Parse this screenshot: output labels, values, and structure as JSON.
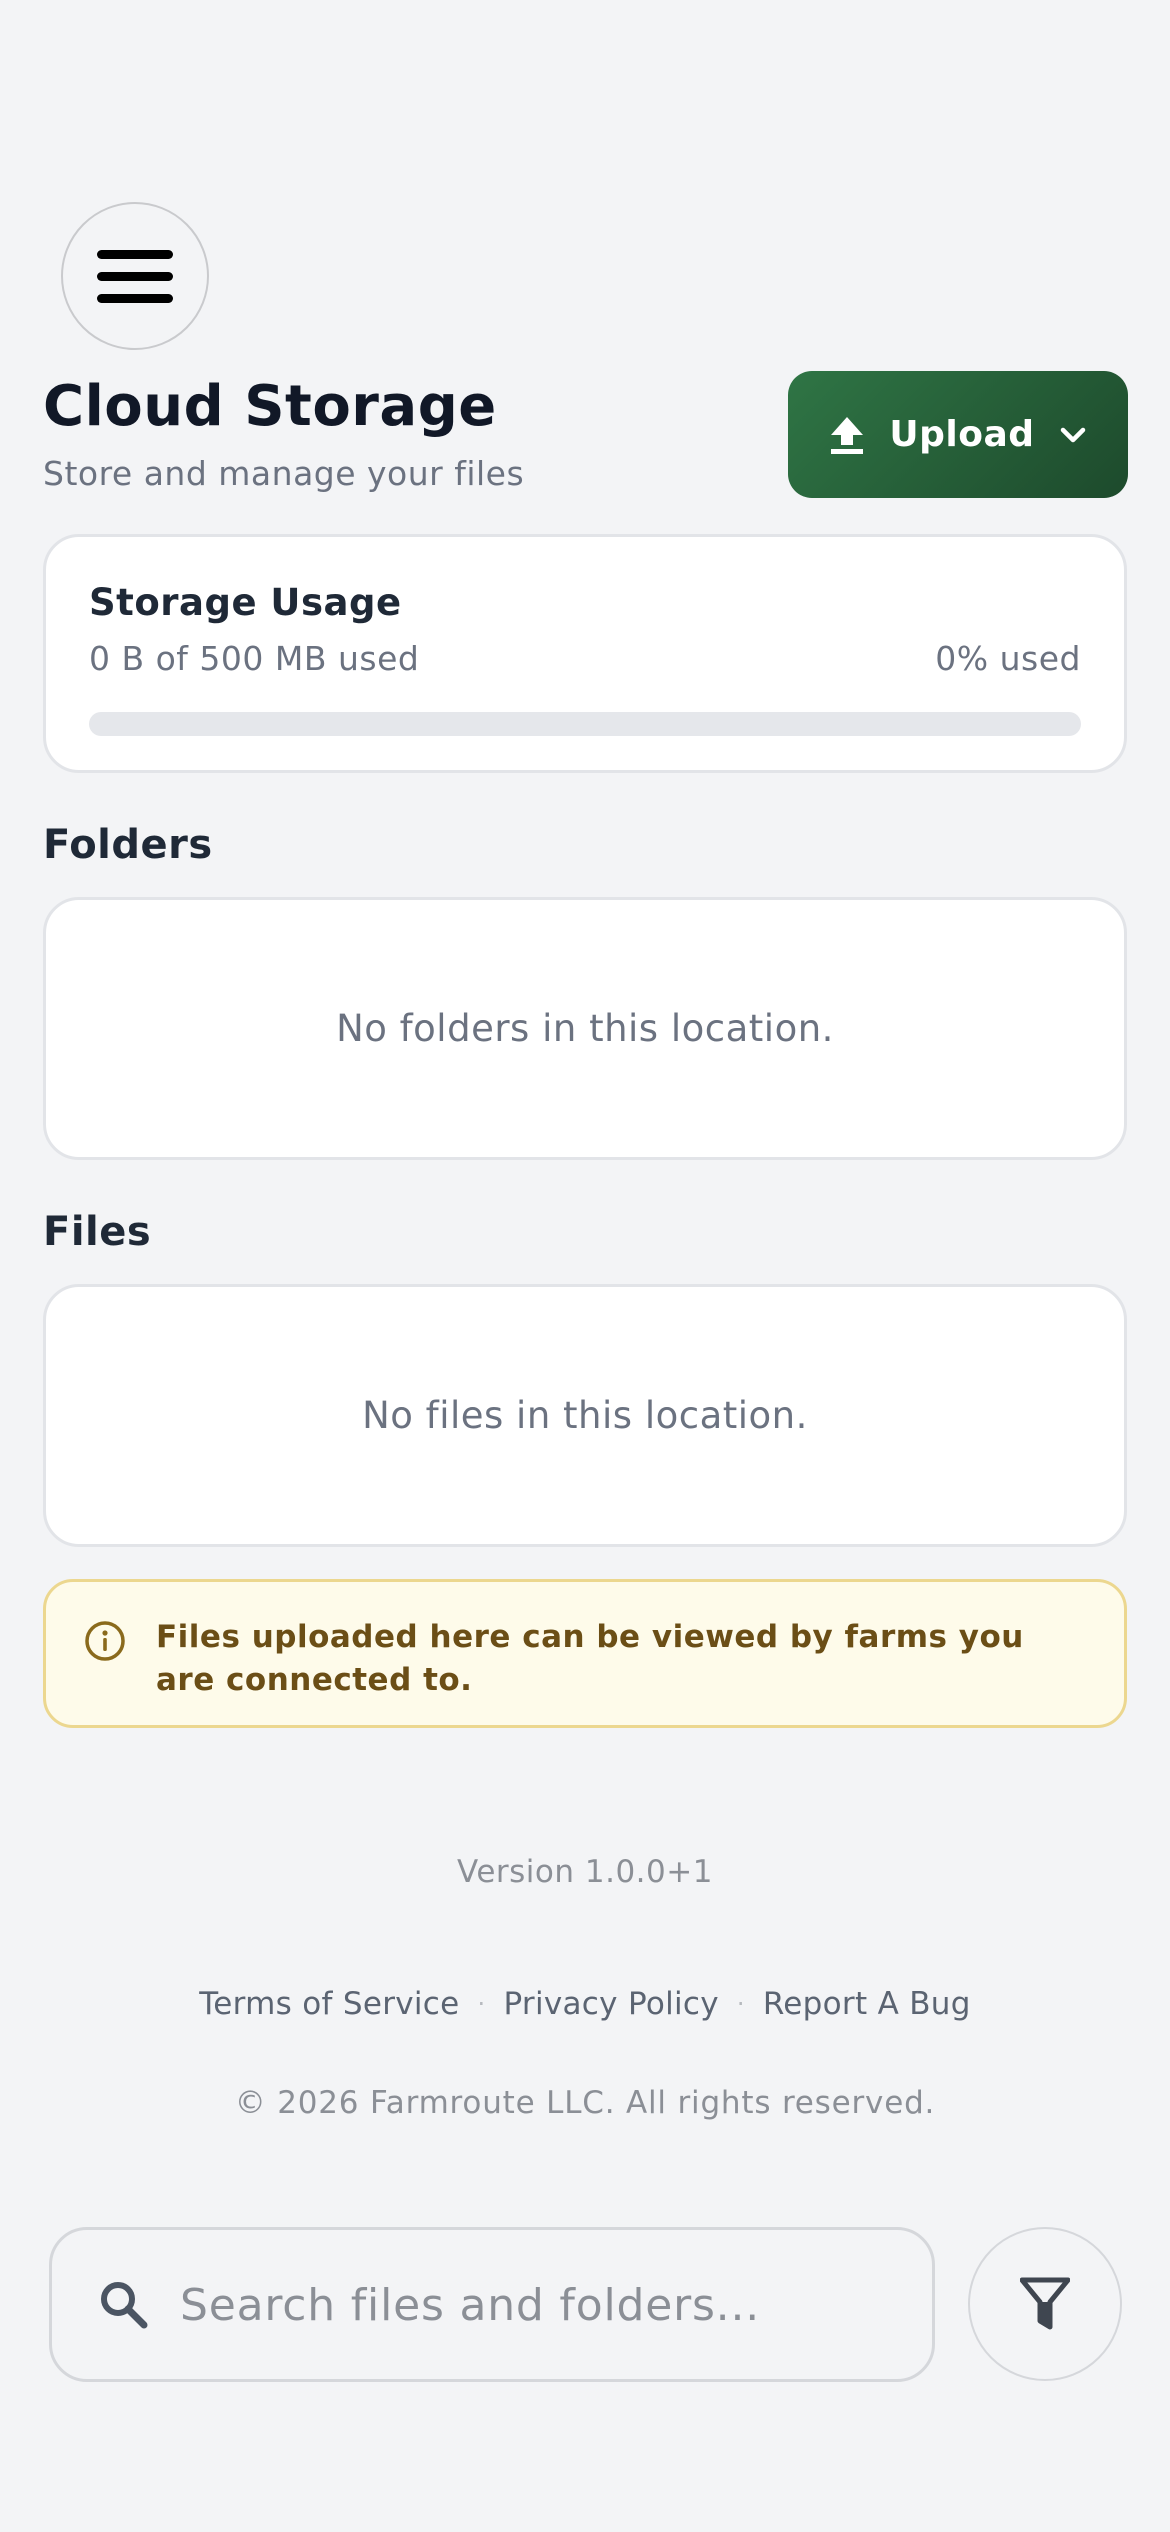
{
  "header": {
    "menu_icon": "hamburger-icon",
    "title": "Cloud Storage",
    "subtitle": "Store and manage your files",
    "upload_label": "Upload",
    "upload_icon": "upload-arrow-icon",
    "upload_dropdown_icon": "chevron-down-icon",
    "accent_color": "#2f7545"
  },
  "storage": {
    "title": "Storage Usage",
    "used_text": "0 B of 500 MB used",
    "percent_text": "0% used",
    "percent_value": 0
  },
  "folders": {
    "title": "Folders",
    "empty_text": "No folders in this location."
  },
  "files": {
    "title": "Files",
    "empty_text": "No files in this location."
  },
  "notice": {
    "icon": "info-circle-icon",
    "text": "Files uploaded here can be viewed by farms you are connected to."
  },
  "footer": {
    "version": "Version 1.0.0+1",
    "links": [
      "Terms of Service",
      "Privacy Policy",
      "Report A Bug"
    ],
    "separator": "·",
    "copyright": "© 2026 Farmroute LLC. All rights reserved."
  },
  "search": {
    "placeholder": "Search files and folders...",
    "value": "",
    "icon": "search-icon",
    "filter_icon": "filter-funnel-icon"
  }
}
